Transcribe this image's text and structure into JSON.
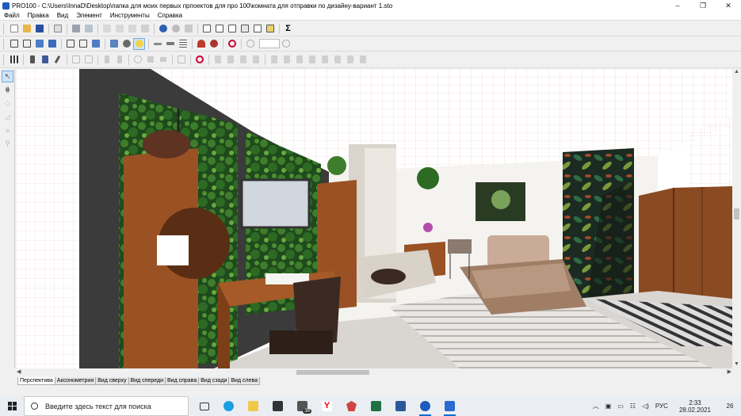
{
  "window": {
    "title": "PRO100 - C:\\Users\\InnaD\\Desktop\\папка для моих первых прпоектов для про 100\\комната для отправки по дизайну-вариант 1.sto",
    "minimize": "–",
    "maximize": "❐",
    "close": "✕"
  },
  "menu": {
    "items": [
      "Файл",
      "Правка",
      "Вид",
      "Элемент",
      "Инструменты",
      "Справка"
    ]
  },
  "toolbar1": {
    "icons": [
      "new-file-icon",
      "open-folder-icon",
      "save-icon",
      "properties-icon",
      "print-icon",
      "print-preview-icon",
      "cut-icon",
      "copy-icon",
      "paste-icon",
      "delete-icon",
      "undo-icon",
      "redo-icon",
      "library-icon",
      "catalog-icon",
      "reports-icon",
      "price-list-icon",
      "materials-icon",
      "export-icon",
      "render-icon",
      "sum-icon"
    ]
  },
  "toolbar2": {
    "icons": [
      "wireframe-icon",
      "hidden-lines-icon",
      "shading-icon",
      "textures-icon",
      "view-wall-icon",
      "view-box-icon",
      "view-solid-icon",
      "lights-icon",
      "materials-ball-icon",
      "bulb-icon",
      "dimension-icon",
      "measure-icon",
      "grid-icon",
      "magnet-icon",
      "snap-icon",
      "target-icon",
      "zoom-in-icon",
      "zoom-out-icon"
    ],
    "zoom_value": ""
  },
  "toolbar3": {
    "icons": [
      "grid-select-icon",
      "move-up-icon",
      "move-icon",
      "edit-icon",
      "arrange-icon",
      "rotate-icon",
      "mirror-icon",
      "rotate-ccw-icon",
      "move-cross-icon",
      "align-icon",
      "group-icon",
      "stop-icon",
      "align-left-icon",
      "align-center-icon",
      "align-right-icon",
      "align-top-icon",
      "align-middle-icon",
      "align-bottom-icon",
      "distribute-h-icon",
      "distribute-v-icon",
      "size-icon",
      "size-match-icon",
      "flip-icon",
      "reset-icon"
    ]
  },
  "tabs": [
    "Перспектива",
    "Аксонометрия",
    "Вид сверху",
    "Вид спереди",
    "Вид справа",
    "Вид сзади",
    "Вид слева"
  ],
  "active_tab": "Перспектива",
  "taskbar": {
    "search_placeholder": "Введите здесь текст для поиска",
    "mail_badge": "39",
    "lang": "РУС",
    "time": "2:33",
    "date": "28.02.2021",
    "notifications": "26"
  },
  "colors": {
    "accent": "#0a6ed1",
    "wood": "#9a5224",
    "wall_dark": "#3b3b3b"
  }
}
